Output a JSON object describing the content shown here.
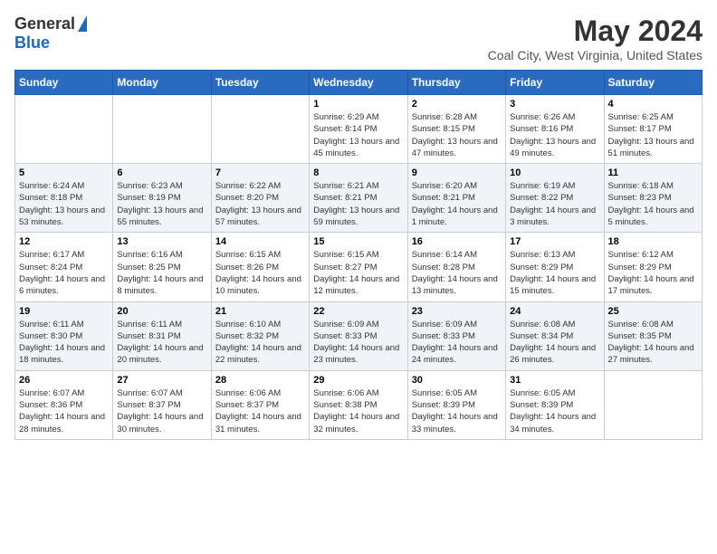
{
  "header": {
    "logo_general": "General",
    "logo_blue": "Blue",
    "month_title": "May 2024",
    "location": "Coal City, West Virginia, United States"
  },
  "days_of_week": [
    "Sunday",
    "Monday",
    "Tuesday",
    "Wednesday",
    "Thursday",
    "Friday",
    "Saturday"
  ],
  "weeks": [
    [
      {
        "day": "",
        "info": ""
      },
      {
        "day": "",
        "info": ""
      },
      {
        "day": "",
        "info": ""
      },
      {
        "day": "1",
        "info": "Sunrise: 6:29 AM\nSunset: 8:14 PM\nDaylight: 13 hours\nand 45 minutes."
      },
      {
        "day": "2",
        "info": "Sunrise: 6:28 AM\nSunset: 8:15 PM\nDaylight: 13 hours\nand 47 minutes."
      },
      {
        "day": "3",
        "info": "Sunrise: 6:26 AM\nSunset: 8:16 PM\nDaylight: 13 hours\nand 49 minutes."
      },
      {
        "day": "4",
        "info": "Sunrise: 6:25 AM\nSunset: 8:17 PM\nDaylight: 13 hours\nand 51 minutes."
      }
    ],
    [
      {
        "day": "5",
        "info": "Sunrise: 6:24 AM\nSunset: 8:18 PM\nDaylight: 13 hours\nand 53 minutes."
      },
      {
        "day": "6",
        "info": "Sunrise: 6:23 AM\nSunset: 8:19 PM\nDaylight: 13 hours\nand 55 minutes."
      },
      {
        "day": "7",
        "info": "Sunrise: 6:22 AM\nSunset: 8:20 PM\nDaylight: 13 hours\nand 57 minutes."
      },
      {
        "day": "8",
        "info": "Sunrise: 6:21 AM\nSunset: 8:21 PM\nDaylight: 13 hours\nand 59 minutes."
      },
      {
        "day": "9",
        "info": "Sunrise: 6:20 AM\nSunset: 8:21 PM\nDaylight: 14 hours\nand 1 minute."
      },
      {
        "day": "10",
        "info": "Sunrise: 6:19 AM\nSunset: 8:22 PM\nDaylight: 14 hours\nand 3 minutes."
      },
      {
        "day": "11",
        "info": "Sunrise: 6:18 AM\nSunset: 8:23 PM\nDaylight: 14 hours\nand 5 minutes."
      }
    ],
    [
      {
        "day": "12",
        "info": "Sunrise: 6:17 AM\nSunset: 8:24 PM\nDaylight: 14 hours\nand 6 minutes."
      },
      {
        "day": "13",
        "info": "Sunrise: 6:16 AM\nSunset: 8:25 PM\nDaylight: 14 hours\nand 8 minutes."
      },
      {
        "day": "14",
        "info": "Sunrise: 6:15 AM\nSunset: 8:26 PM\nDaylight: 14 hours\nand 10 minutes."
      },
      {
        "day": "15",
        "info": "Sunrise: 6:15 AM\nSunset: 8:27 PM\nDaylight: 14 hours\nand 12 minutes."
      },
      {
        "day": "16",
        "info": "Sunrise: 6:14 AM\nSunset: 8:28 PM\nDaylight: 14 hours\nand 13 minutes."
      },
      {
        "day": "17",
        "info": "Sunrise: 6:13 AM\nSunset: 8:29 PM\nDaylight: 14 hours\nand 15 minutes."
      },
      {
        "day": "18",
        "info": "Sunrise: 6:12 AM\nSunset: 8:29 PM\nDaylight: 14 hours\nand 17 minutes."
      }
    ],
    [
      {
        "day": "19",
        "info": "Sunrise: 6:11 AM\nSunset: 8:30 PM\nDaylight: 14 hours\nand 18 minutes."
      },
      {
        "day": "20",
        "info": "Sunrise: 6:11 AM\nSunset: 8:31 PM\nDaylight: 14 hours\nand 20 minutes."
      },
      {
        "day": "21",
        "info": "Sunrise: 6:10 AM\nSunset: 8:32 PM\nDaylight: 14 hours\nand 22 minutes."
      },
      {
        "day": "22",
        "info": "Sunrise: 6:09 AM\nSunset: 8:33 PM\nDaylight: 14 hours\nand 23 minutes."
      },
      {
        "day": "23",
        "info": "Sunrise: 6:09 AM\nSunset: 8:33 PM\nDaylight: 14 hours\nand 24 minutes."
      },
      {
        "day": "24",
        "info": "Sunrise: 6:08 AM\nSunset: 8:34 PM\nDaylight: 14 hours\nand 26 minutes."
      },
      {
        "day": "25",
        "info": "Sunrise: 6:08 AM\nSunset: 8:35 PM\nDaylight: 14 hours\nand 27 minutes."
      }
    ],
    [
      {
        "day": "26",
        "info": "Sunrise: 6:07 AM\nSunset: 8:36 PM\nDaylight: 14 hours\nand 28 minutes."
      },
      {
        "day": "27",
        "info": "Sunrise: 6:07 AM\nSunset: 8:37 PM\nDaylight: 14 hours\nand 30 minutes."
      },
      {
        "day": "28",
        "info": "Sunrise: 6:06 AM\nSunset: 8:37 PM\nDaylight: 14 hours\nand 31 minutes."
      },
      {
        "day": "29",
        "info": "Sunrise: 6:06 AM\nSunset: 8:38 PM\nDaylight: 14 hours\nand 32 minutes."
      },
      {
        "day": "30",
        "info": "Sunrise: 6:05 AM\nSunset: 8:39 PM\nDaylight: 14 hours\nand 33 minutes."
      },
      {
        "day": "31",
        "info": "Sunrise: 6:05 AM\nSunset: 8:39 PM\nDaylight: 14 hours\nand 34 minutes."
      },
      {
        "day": "",
        "info": ""
      }
    ]
  ]
}
